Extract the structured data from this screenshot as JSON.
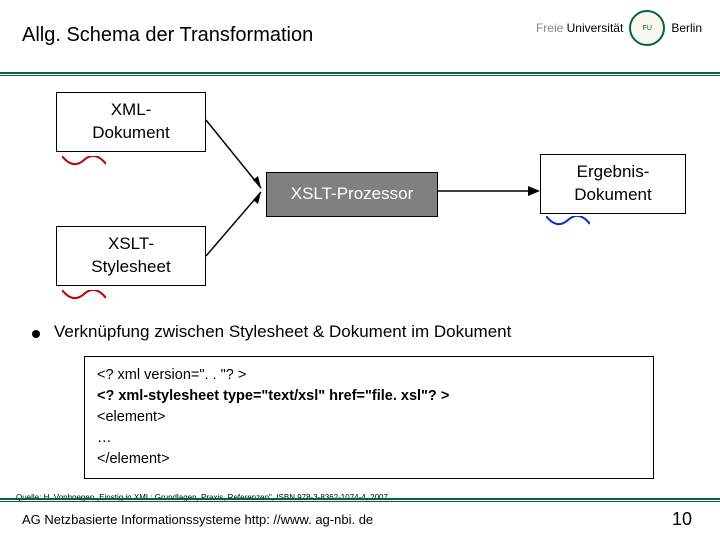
{
  "header": {
    "title": "Allg. Schema der Transformation",
    "logo_prefix": "Freie",
    "logo_main": "Universität",
    "logo_city": "Berlin"
  },
  "diagram": {
    "xml_doc_l1": "XML-",
    "xml_doc_l2": "Dokument",
    "processor": "XSLT-Prozessor",
    "result_l1": "Ergebnis-",
    "result_l2": "Dokument",
    "stylesheet_l1": "XSLT-",
    "stylesheet_l2": "Stylesheet"
  },
  "bullet": "Verknüpfung zwischen Stylesheet & Dokument im Dokument",
  "code": {
    "l1": "<? xml version=\". . \"? >",
    "l2": "<? xml-stylesheet type=\"text/xsl\" href=\"file. xsl\"? >",
    "l3": "  <element>",
    "l4": "    …",
    "l5": "  </element>"
  },
  "source": "Quelle: H. Vonhoegen „Einstig in XML: Grundlagen, Praxis, Referenzen\", ISBN 978-3-8362-1074-4, 2007",
  "footer": {
    "left": "AG Netzbasierte Informationssysteme http: //www. ag-nbi. de",
    "page": "10"
  }
}
